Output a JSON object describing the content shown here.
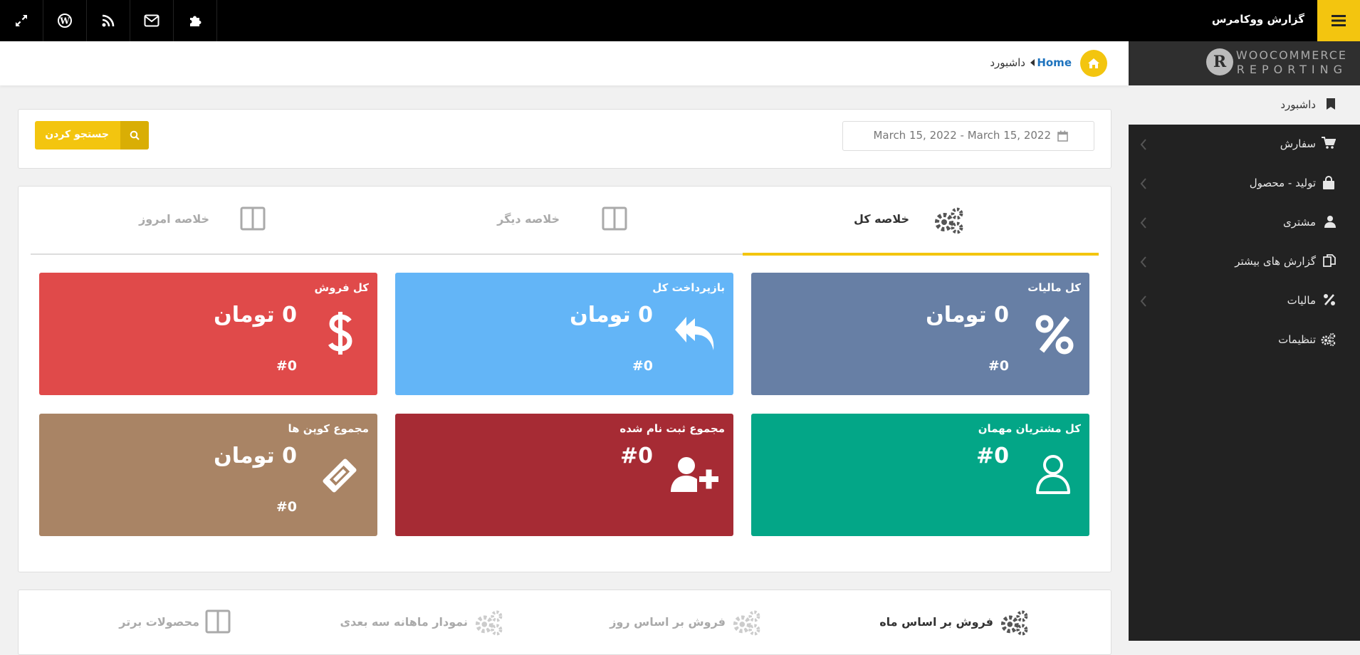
{
  "topbar": {
    "title": "گزارش ووکامرس",
    "icons": [
      "expand-icon",
      "wordpress-icon",
      "rss-icon",
      "envelope-icon",
      "puzzle-icon"
    ],
    "accent": "#f3c50f"
  },
  "sidebar": {
    "logo_line1": "WOOCOMMERCE",
    "logo_line2": "REPORTING",
    "logo_letter": "R",
    "items": [
      {
        "label": "داشبورد",
        "icon": "bookmark-icon",
        "active": true
      },
      {
        "label": "سفارش",
        "icon": "cart-icon",
        "has_submenu": true
      },
      {
        "label": "تولید - محصول",
        "icon": "shopping-bag-icon",
        "has_submenu": true
      },
      {
        "label": "مشتری",
        "icon": "user-icon",
        "has_submenu": true
      },
      {
        "label": "گزارش های بیشتر",
        "icon": "copy-icon",
        "has_submenu": true
      },
      {
        "label": "مالیات",
        "icon": "percent-icon",
        "has_submenu": true
      },
      {
        "label": "تنظیمات",
        "icon": "gears-icon"
      }
    ]
  },
  "breadcrumb": {
    "home": "Home",
    "current": "داشبورد"
  },
  "filter": {
    "date_range": "March 15, 2022 - March 15, 2022",
    "search_label": "جستجو کردن"
  },
  "tabs": [
    {
      "label": "خلاصه کل",
      "icon": "gears-icon",
      "active": true
    },
    {
      "label": "خلاصه دیگر",
      "icon": "columns-icon"
    },
    {
      "label": "خلاصه امروز",
      "icon": "columns-icon"
    }
  ],
  "cards": [
    {
      "title": "کل مالیات",
      "value": "0 تومان",
      "count": "#0",
      "icon": "percent-icon",
      "color": "#677fa5"
    },
    {
      "title": "بازپرداخت کل",
      "value": "0 تومان",
      "count": "#0",
      "icon": "reply-all-icon",
      "color": "#63b5f7"
    },
    {
      "title": "کل فروش",
      "value": "0 تومان",
      "count": "#0",
      "icon": "dollar-icon",
      "color": "#e04a4a"
    },
    {
      "title": "کل مشتریان مهمان",
      "value": "#0",
      "icon": "user-outline-icon",
      "color": "#03a687"
    },
    {
      "title": "مجموع ثبت نام شده",
      "value": "#0",
      "icon": "user-plus-icon",
      "color": "#a62b34"
    },
    {
      "title": "مجموع کوپن ها",
      "value": "0 تومان",
      "count": "#0",
      "icon": "ticket-icon",
      "color": "#a98465"
    }
  ],
  "bottom_tabs": [
    {
      "label": "فروش بر اساس ماه",
      "icon": "gears-icon",
      "active": true
    },
    {
      "label": "فروش بر اساس روز",
      "icon": "gears-icon"
    },
    {
      "label": "نمودار ماهانه سه بعدی",
      "icon": "gears-icon"
    },
    {
      "label": "محصولات برتر",
      "icon": "columns-icon"
    }
  ]
}
